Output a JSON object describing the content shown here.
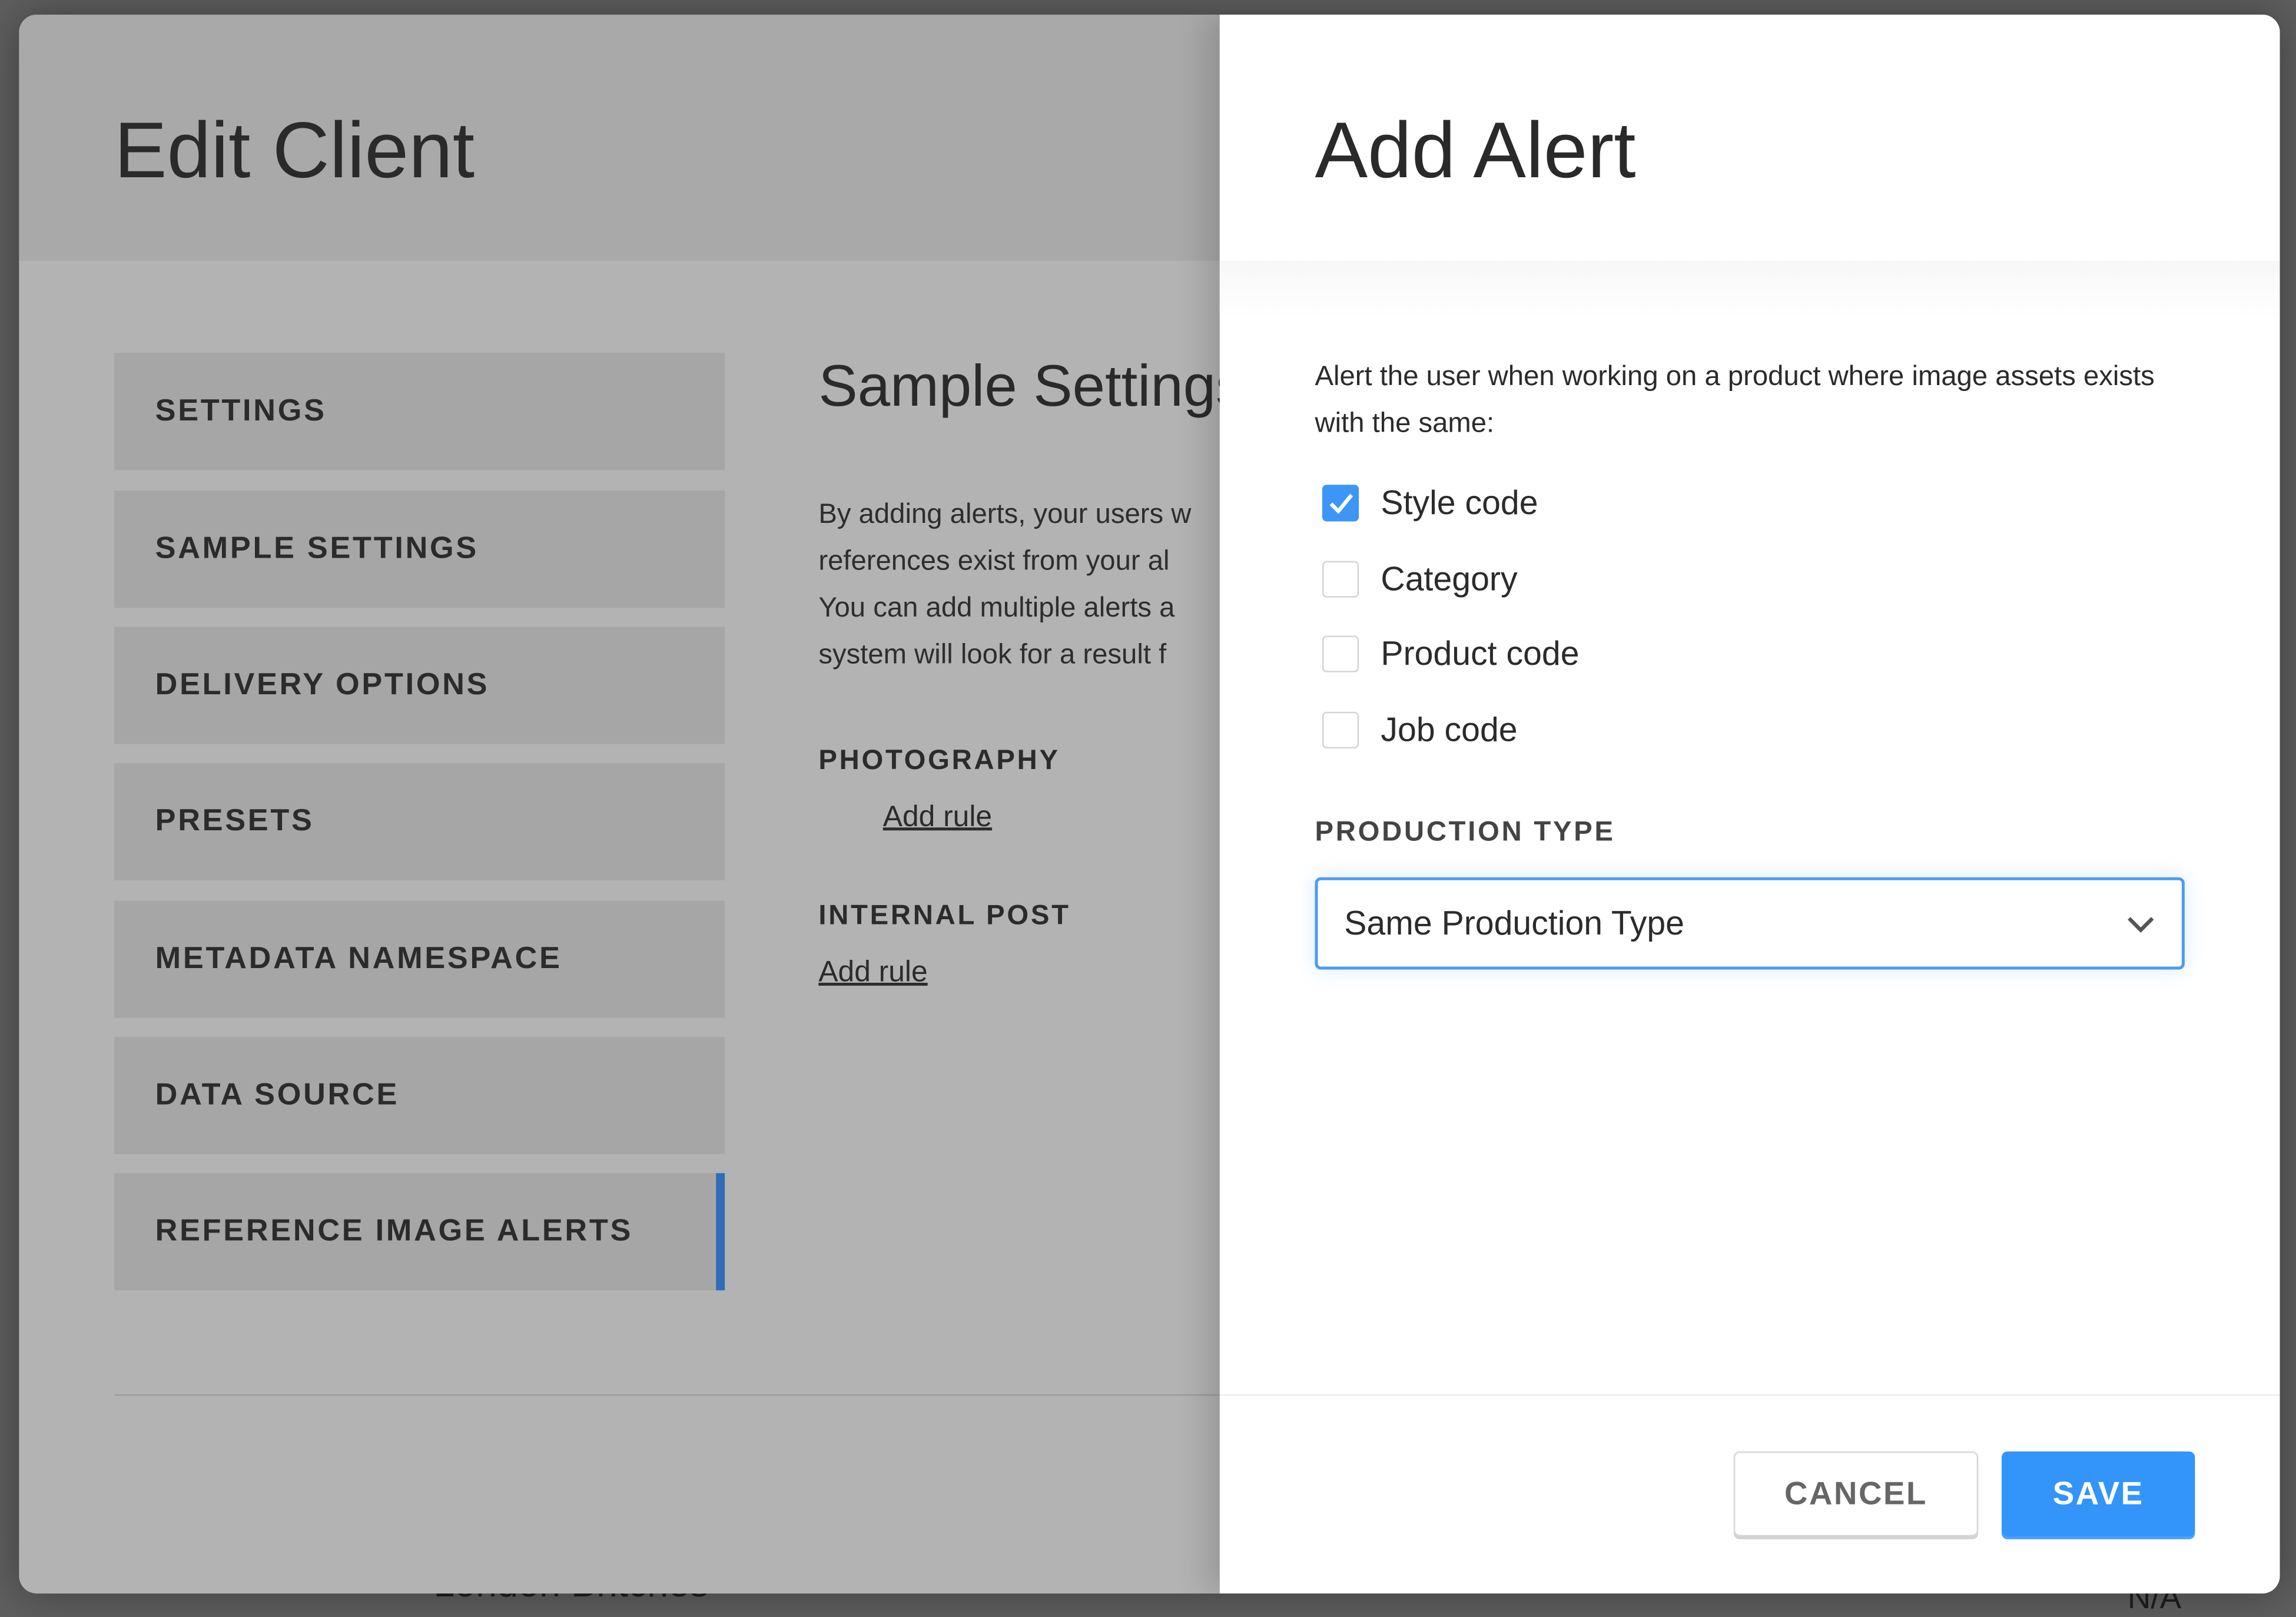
{
  "background": {
    "row_name": "London Britches",
    "row_value": "N/A"
  },
  "left_panel": {
    "title": "Edit Client",
    "nav": [
      {
        "label": "SETTINGS",
        "active": false
      },
      {
        "label": "SAMPLE SETTINGS",
        "active": false
      },
      {
        "label": "DELIVERY OPTIONS",
        "active": false
      },
      {
        "label": "PRESETS",
        "active": false
      },
      {
        "label": "METADATA NAMESPACE",
        "active": false
      },
      {
        "label": "DATA SOURCE",
        "active": false
      },
      {
        "label": "REFERENCE IMAGE ALERTS",
        "active": true
      }
    ],
    "section_title": "Sample Settings",
    "description_lines": [
      "By adding alerts, your users w",
      "references exist from your al",
      "You can add multiple alerts a",
      "system will look for a result f"
    ],
    "groups": [
      {
        "label": "PHOTOGRAPHY",
        "link": "Add rule"
      },
      {
        "label": "INTERNAL POST",
        "link": "Add rule"
      }
    ]
  },
  "add_alert": {
    "title": "Add Alert",
    "description": "Alert the user when working on a product where image assets exists with the same:",
    "options": [
      {
        "label": "Style code",
        "checked": true
      },
      {
        "label": "Category",
        "checked": false
      },
      {
        "label": "Product code",
        "checked": false
      },
      {
        "label": "Job code",
        "checked": false
      }
    ],
    "production_type_label": "PRODUCTION TYPE",
    "production_type_value": "Same Production Type",
    "cancel_label": "CANCEL",
    "save_label": "SAVE"
  },
  "colors": {
    "accent": "#3394fa",
    "checkbox": "#3d95f6",
    "overlay": "#5f5f5f"
  }
}
